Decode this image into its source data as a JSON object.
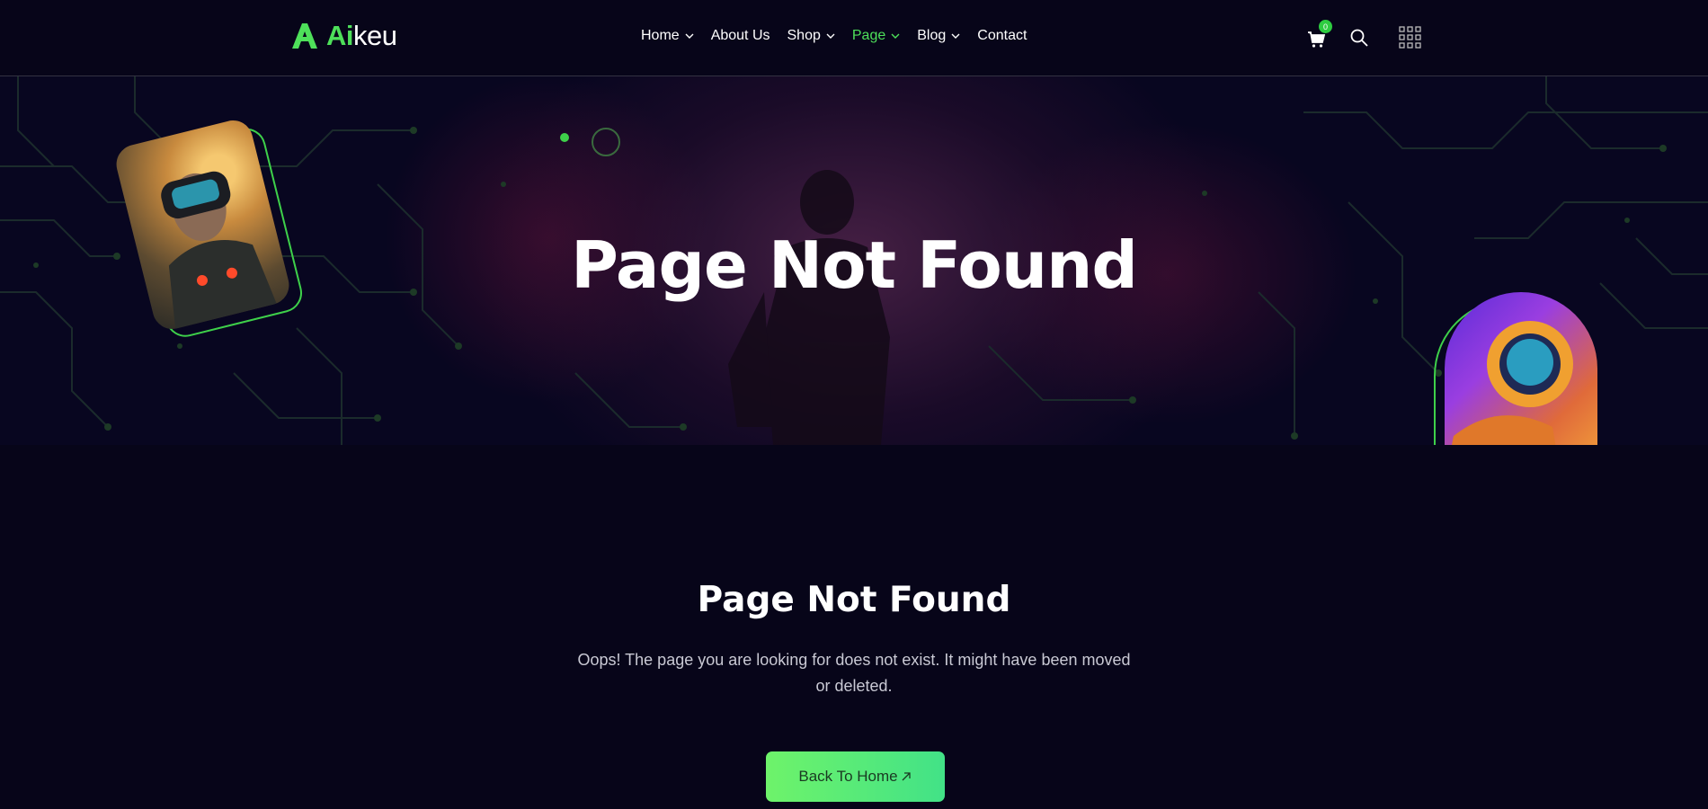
{
  "brand": {
    "ai": "Ai",
    "rest": "keu",
    "accent": "#4ee05a"
  },
  "nav": [
    {
      "label": "Home",
      "dropdown": true,
      "active": false
    },
    {
      "label": "About Us",
      "dropdown": false,
      "active": false
    },
    {
      "label": "Shop",
      "dropdown": true,
      "active": false
    },
    {
      "label": "Page",
      "dropdown": true,
      "active": true
    },
    {
      "label": "Blog",
      "dropdown": true,
      "active": false
    },
    {
      "label": "Contact",
      "dropdown": false,
      "active": false
    }
  ],
  "header_icons": {
    "cart_count": "0",
    "cart": "cart-icon",
    "search": "search-icon",
    "menu": "grid-menu-icon"
  },
  "hero": {
    "title": "Page Not Found"
  },
  "content": {
    "title": "Page Not Found",
    "text": "Oops! The page you are looking for does not exist. It might have been moved or deleted.",
    "button_label": "Back To Home"
  },
  "colors": {
    "background": "#070519",
    "accent": "#4ee05a",
    "button_start": "#6ef36a",
    "button_end": "#42e287"
  }
}
